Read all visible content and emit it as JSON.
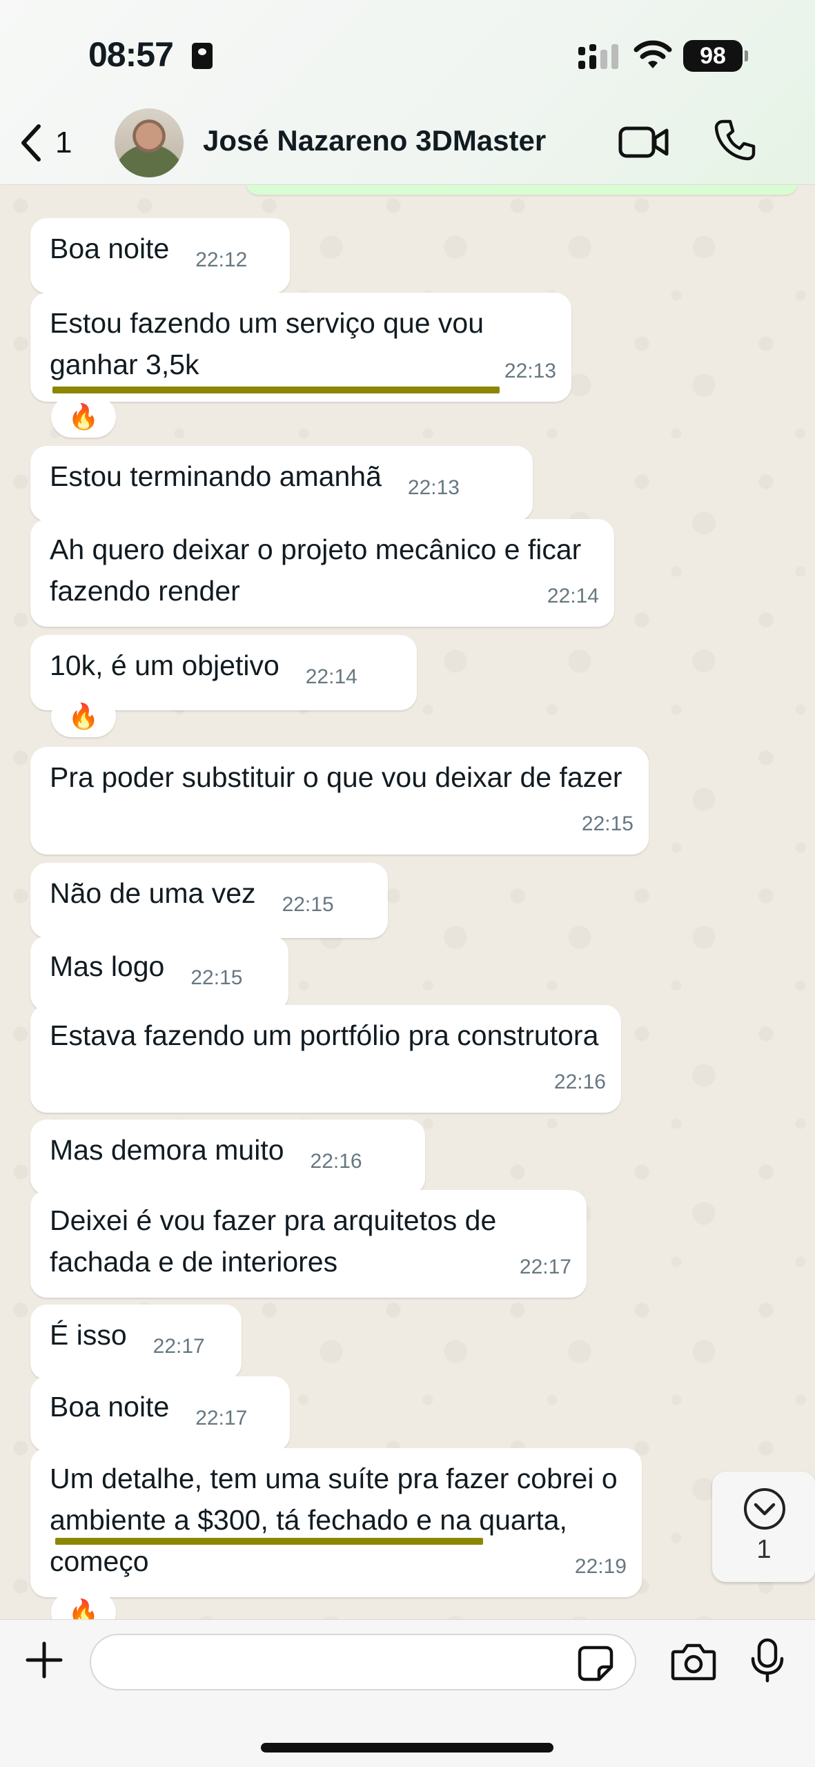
{
  "status_bar": {
    "time": "08:57",
    "battery": "98"
  },
  "header": {
    "back_count": "1",
    "contact_name": "José Nazareno 3DMaster"
  },
  "messages": [
    {
      "text": "Boa noite",
      "time": "22:12"
    },
    {
      "text": "Estou fazendo um serviço que vou ganhar 3,5k",
      "time": "22:13",
      "reaction": "🔥"
    },
    {
      "text": "Estou terminando amanhã",
      "time": "22:13"
    },
    {
      "text": "Ah quero deixar o projeto mecânico e ficar fazendo render",
      "time": "22:14"
    },
    {
      "text": "10k, é um objetivo",
      "time": "22:14",
      "reaction": "🔥"
    },
    {
      "text": "Pra poder substituir o que vou deixar de fazer",
      "time": "22:15"
    },
    {
      "text": "Não de uma vez",
      "time": "22:15"
    },
    {
      "text": "Mas logo",
      "time": "22:15"
    },
    {
      "text": "Estava fazendo um portfólio pra construtora",
      "time": "22:16"
    },
    {
      "text": "Mas demora muito",
      "time": "22:16"
    },
    {
      "text": "Deixei é vou fazer pra arquitetos de fachada e de interiores",
      "time": "22:17"
    },
    {
      "text": "É isso",
      "time": "22:17"
    },
    {
      "text": "Boa noite",
      "time": "22:17"
    },
    {
      "text": "Um detalhe, tem uma suíte pra fazer cobrei o ambiente a $300, tá fechado e na quarta, começo",
      "time": "22:19",
      "reaction": "🔥"
    }
  ],
  "scroll_button": {
    "count": "1"
  },
  "composer": {
    "placeholder": ""
  }
}
